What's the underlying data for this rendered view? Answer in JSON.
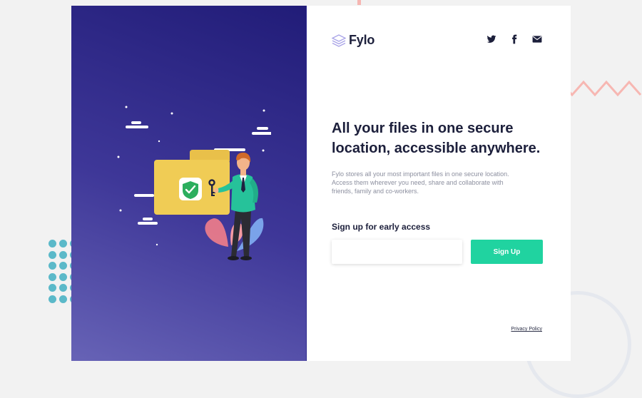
{
  "brand": {
    "name": "Fylo",
    "logo_icon": "fylo-logo-icon"
  },
  "social": [
    {
      "name": "twitter",
      "icon": "twitter-icon"
    },
    {
      "name": "facebook",
      "icon": "facebook-icon"
    },
    {
      "name": "email",
      "icon": "envelope-icon"
    }
  ],
  "hero": {
    "headline": "All your files in one secure location, accessible anywhere.",
    "description": "Fylo stores all your most important files in one secure location. Access them wherever you need, share and collaborate with friends, family and co-workers."
  },
  "signup": {
    "label": "Sign up for early access",
    "email_value": "",
    "email_placeholder": "",
    "button_label": "Sign Up"
  },
  "footer": {
    "privacy_link": "Privacy Policy"
  },
  "colors": {
    "hero_gradient": [
      "#211c78",
      "#3e3798",
      "#6763b6"
    ],
    "accent": "#20d3a0",
    "text_dark": "#1c1f3b",
    "text_muted": "#8c8f9f",
    "page_background": "#f2f2f2"
  }
}
